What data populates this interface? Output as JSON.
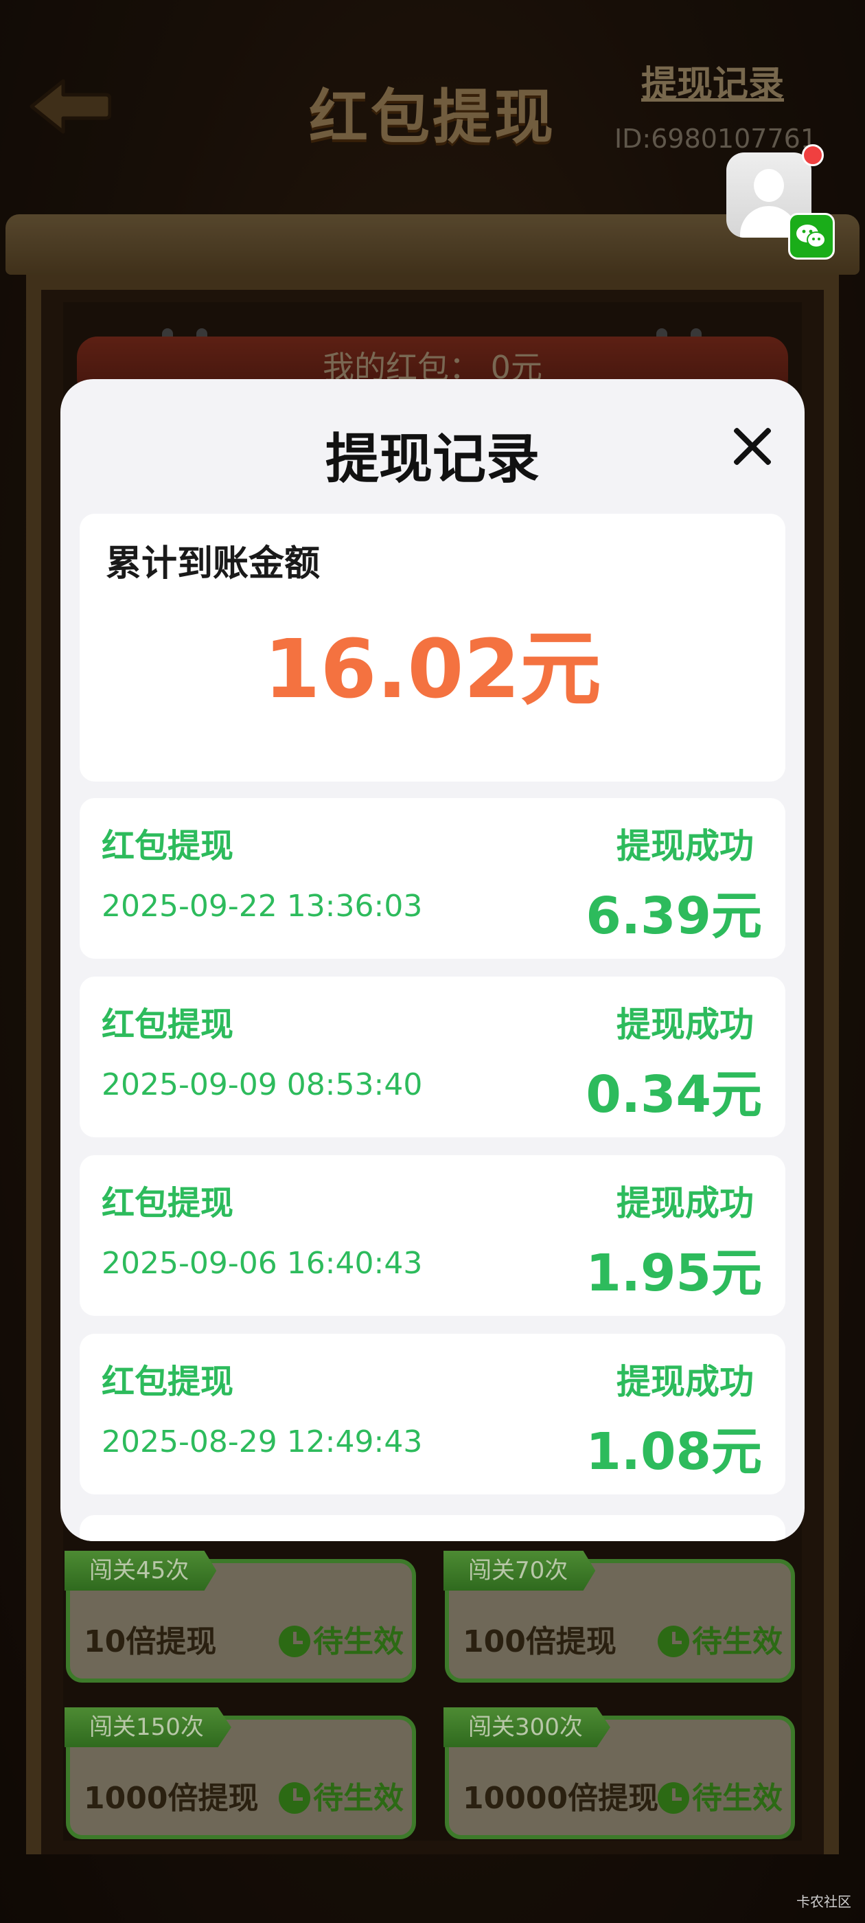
{
  "background": {
    "title": "红包提现",
    "record_link": "提现记录",
    "user_id": "ID:6980107761",
    "red_packet_label": "我的红包：",
    "red_packet_value": "0元",
    "tasks": [
      {
        "tag": "闯关45次",
        "name": "10倍提现",
        "status": "待生效"
      },
      {
        "tag": "闯关70次",
        "name": "100倍提现",
        "status": "待生效"
      },
      {
        "tag": "闯关150次",
        "name": "1000倍提现",
        "status": "待生效"
      },
      {
        "tag": "闯关300次",
        "name": "10000倍提现",
        "status": "待生效"
      }
    ],
    "watermark": "卡农社区"
  },
  "modal": {
    "title": "提现记录",
    "total_label": "累计到账金额",
    "total_amount": "16.02元",
    "records": [
      {
        "type": "红包提现",
        "status": "提现成功",
        "time": "2025-09-22 13:36:03",
        "amount": "6.39元"
      },
      {
        "type": "红包提现",
        "status": "提现成功",
        "time": "2025-09-09 08:53:40",
        "amount": "0.34元"
      },
      {
        "type": "红包提现",
        "status": "提现成功",
        "time": "2025-09-06 16:40:43",
        "amount": "1.95元"
      },
      {
        "type": "红包提现",
        "status": "提现成功",
        "time": "2025-08-29 12:49:43",
        "amount": "1.08元"
      }
    ]
  },
  "colors": {
    "amount_orange": "#f47240",
    "success_green": "#2dbb5c",
    "wechat_green": "#1aad19"
  },
  "icons": [
    "back-arrow-icon",
    "avatar-icon",
    "wechat-icon",
    "close-icon",
    "clock-icon"
  ]
}
